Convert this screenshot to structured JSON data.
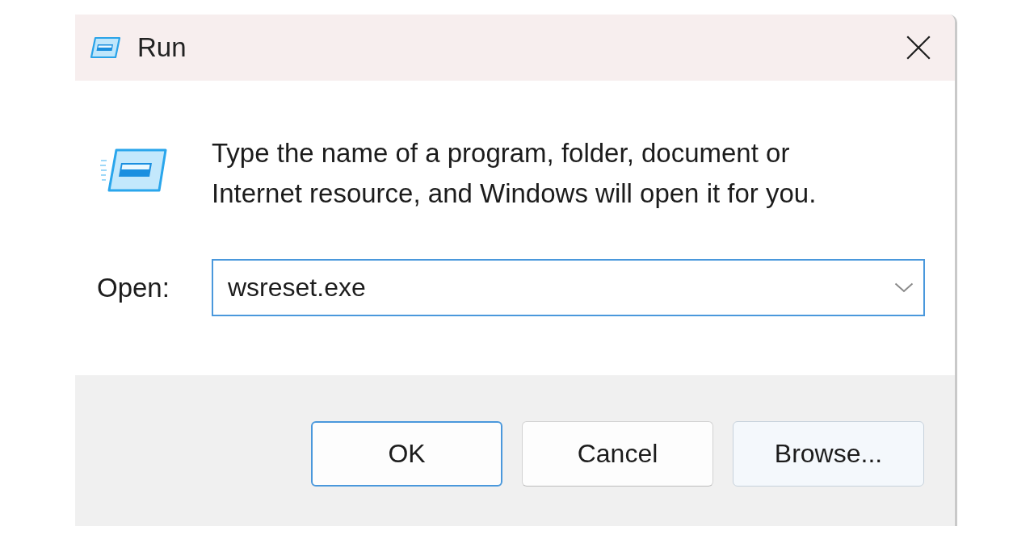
{
  "window": {
    "title": "Run"
  },
  "description": "Type the name of a program, folder, document or Internet resource, and Windows will open it for you.",
  "open_field": {
    "label": "Open:",
    "value": "wsreset.exe",
    "focused": true
  },
  "buttons": [
    {
      "label": "OK",
      "default": true,
      "hovered": false
    },
    {
      "label": "Cancel",
      "default": false,
      "hovered": false
    },
    {
      "label": "Browse...",
      "default": false,
      "hovered": true
    }
  ]
}
